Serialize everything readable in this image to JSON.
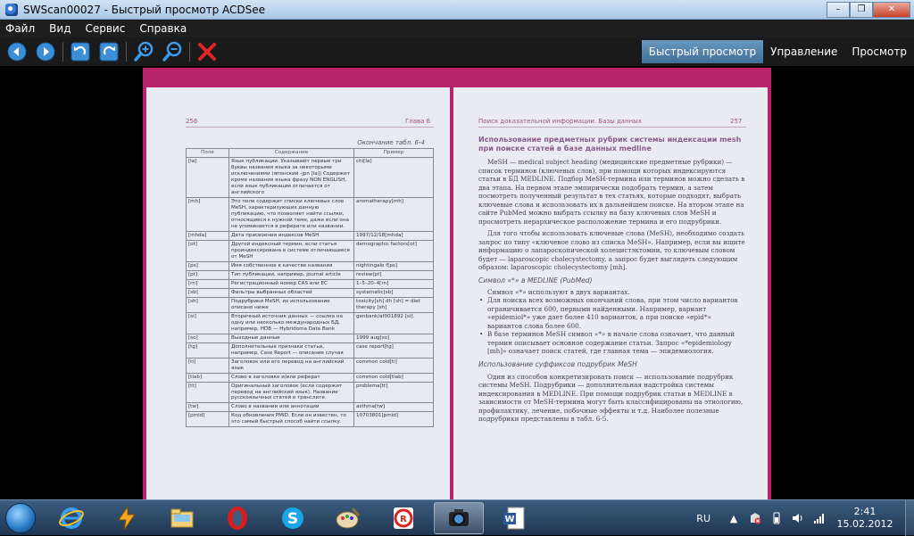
{
  "window": {
    "title": "SWScan00027 - Быстрый просмотр ACDSee",
    "minimize_label": "–",
    "restore_label": "❐",
    "close_label": "✕"
  },
  "menu": [
    "Файл",
    "Вид",
    "Сервис",
    "Справка"
  ],
  "toolbar": {
    "icons": [
      "back-icon",
      "forward-icon",
      "rotate-left-icon",
      "rotate-right-icon",
      "zoom-in-icon",
      "zoom-out-icon",
      "delete-icon"
    ],
    "modes": [
      "Быстрый просмотр",
      "Управление",
      "Просмотр"
    ],
    "active_mode": "Быстрый просмотр"
  },
  "document": {
    "left_page_number": "256",
    "left_chapter": "Глава 6",
    "table_caption": "Окончание табл. 6-4",
    "table_headers": [
      "Поле",
      "Содержание",
      "Пример"
    ],
    "table_rows": [
      [
        "[la]",
        "Язык публикации. Указывают первые три буквы названия языка за некоторыми исключениями (японский -jpn [la]) Содержит кроме названия языка фразу NON ENGLISH, если язык публикации отличается от английского",
        "chi[la]"
      ],
      [
        "[mh]",
        "Это поле содержит списки ключевых слов MeSH, характеризующих данную публикацию, что позволяет найти ссылки, относящиеся к нужной теме, даже если она не упоминается в реферате или названии.",
        "aromatherapy[mh]"
      ],
      [
        "[mhda]",
        "Дата присвоения индексов MeSH",
        "1997/12/18[mhda]"
      ],
      [
        "[ot]",
        "Другой индексный термин, если статья проиндексирована в системе отличающееся от MeSH",
        "demographic factors[ot]"
      ],
      [
        "[ps]",
        "Имя собственное в качестве названия",
        "nightingale f[ps]"
      ],
      [
        "[pt]",
        "Тип публикации, например, journal article",
        "review[pt]"
      ],
      [
        "[rn]",
        "Регистрационный номер CAS или EC",
        "1–5–20–4[rn]"
      ],
      [
        "[sb]",
        "Фильтры выбранных областей",
        "systematic[sb]"
      ],
      [
        "[sh]",
        "Подрубрики MeSH, их использование описано ниже",
        "toxicity[sh] dh [sh] = diet therapy [sh]"
      ],
      [
        "[si]",
        "Вторичный источник данных — ссылка на одну или несколько международных БД, например, HDB — Hybridoma Data Bank",
        "genbank/af001892 [si]."
      ],
      [
        "[so]",
        "Выходные данные",
        "1999 aug[so]"
      ],
      [
        "[tg]",
        "Дополнительные признаки статьи, например, Case Report — описание случая",
        "case report[tg]"
      ],
      [
        "[ti]",
        "Заголовок или его перевод на английский язык",
        "common cold[ti]"
      ],
      [
        "[tiab]",
        "Слово в заголовке и/или реферат",
        "common cold[tiab]"
      ],
      [
        "[tt]",
        "Оригинальный заголовок (если содержит перевод на английский язык). Название русскоязычных статей в транслите.",
        "problema[tt]"
      ],
      [
        "[tw]",
        "Слово в названии или аннотации",
        "asthma[tw]"
      ],
      [
        "[pmid]",
        "Код обновления PMID. Если он известен, то это самый быстрый способ найти ссылку.",
        "10703801[pmid]"
      ]
    ],
    "right_header_left": "Поиск доказательной информации. Базы данных",
    "right_page_number": "257",
    "section_heading": "Использование предметных рубрик системы индексации mesh при поиске статей в базе данных medline",
    "para1": "MeSH — medical subject heading (медицинские предметные рубрики) — список терминов (ключевых слов), при помощи которых индексируются статьи в БД MEDLINE. Подбор MeSH-термина или терминов можно сделать в два этапа. На первом этапе эмпирически подобрать термин, а затем посмотреть полученный результат в тех статьях, которые подходят, выбрать ключевые слова и использовать их в дальнейшем поиске. На втором этапе на сайте PubMed можно выбрать ссылку на базу ключевых слов MeSH и просмотреть иерархическое расположение термина и его подрубрики.",
    "para2": "Для того чтобы использовать ключевые слова (MeSH), необходимо создать запрос по типу «ключевое слово из списка MeSH». Например, если вы ищите информацию о лапароскопической холецистэктомии, то ключевым словом будет — laparoscopic cholecystectomy, а запрос будет выглядеть следующим образом: laparoscopic cholecystectomy [mh].",
    "subheading1": "Символ «*» в MEDLINE (PubMed)",
    "para3": "Символ «*» используют в двух вариантах.",
    "bullets": [
      "Для поиска всех возможных окончаний слова, при этом число вариантов ограничивается 600, первыми найденными. Например, вариант «epidemiol*» уже дает более 410 вариантов, а при поиске «epid*» вариантов слова более 600.",
      "В базе терминов MeSH символ «*» в начале слова означает, что данный термин описывает основное содержание статьи. Запрос «*epidemiology [mh]» означает поиск статей, где главная тема — эпидемиология."
    ],
    "subheading2": "Использование суффиксов подрубрик MeSH",
    "para4": "Один из способов конкретизировать поиск — использование подрубрик системы MeSH. Подрубрики — дополнительная надстройка системы индексирования в MEDLINE. При помощи подрубрик статьи в MEDLINE в зависимости от MeSH-термина могут быть классифицированы на этиологию, профилактику, лечение, побочные эффекты и т.д. Наиболее полезные подрубрики представлены в табл. 6-5."
  },
  "taskbar": {
    "apps": [
      "windows-explorer-ie-icon",
      "internet-explorer-icon",
      "winamp-icon",
      "file-explorer-icon",
      "opera-icon",
      "skype-icon",
      "paint-icon",
      "foxit-reader-icon",
      "acdsee-icon",
      "word-icon"
    ],
    "active_app": "acdsee-icon",
    "language": "RU",
    "time": "2:41",
    "date": "15.02.2012"
  },
  "colors": {
    "accent": "#4a7fab",
    "scan_edge": "#b8226a",
    "page": "#e9ebf3"
  }
}
